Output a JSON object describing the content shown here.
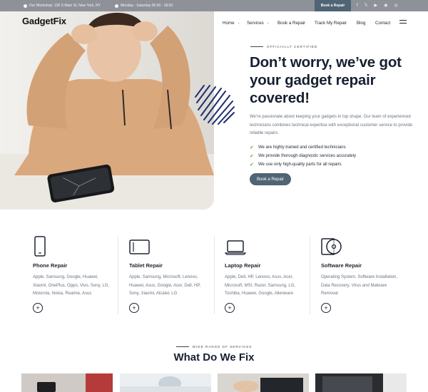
{
  "topbar": {
    "address": "Our Workshop: 100 S Main St, New York, NY",
    "hours": "Monday - Saturday 06.00 - 18.00",
    "cta": "Book a Repair",
    "social": [
      "f",
      "𝕏",
      "▶",
      "◉",
      "◎"
    ]
  },
  "header": {
    "logo": "GadgetFix",
    "nav": {
      "home": "Home",
      "services": "Services",
      "book": "Book a Repair",
      "track": "Track My Repair",
      "blog": "Blog",
      "contact": "Contact"
    }
  },
  "hero": {
    "eyebrow": "OFFICIALLY CERTIFIED",
    "title": "Don’t worry, we’ve got your gadget repair covered!",
    "description": "We’re passionate about keeping your gadgets in top shape. Our team of experienced technicians combines technical expertise with exceptional customer service to provide reliable repairs.",
    "checks": [
      "We are highly trained and certified technicians",
      "We provide thorough diagnostic services accurately",
      "We use only high-quality parts for all repairs"
    ],
    "button": "Book a Repair"
  },
  "services": [
    {
      "name": "Phone Repair",
      "desc": "Apple, Samsung, Google, Huawei, Xiaomi, OnePlus, Oppo, Vivo, Sony, LG, Motorola, Nokia, Realme, Asus"
    },
    {
      "name": "Tablet Repair",
      "desc": "Apple, Samsung, Microsoft, Lenovo, Huawei, Asus, Google, Acer, Dell, HP, Sony, Xiaomi, Alcatel, LG"
    },
    {
      "name": "Laptop Repair",
      "desc": "Apple, Dell, HP, Lenovo, Asus, Acer, Microsoft, MSI, Razer, Samsung, LG, Toshiba, Huawei, Google, Alienware"
    },
    {
      "name": "Software Repair",
      "desc": "Operating System, Software Installation, Data Recovery, Virus and Malware Removal"
    }
  ],
  "plus_symbol": "+",
  "section2": {
    "eyebrow": "WIDE RANGE OF SERVICES",
    "title": "What Do We Fix"
  }
}
